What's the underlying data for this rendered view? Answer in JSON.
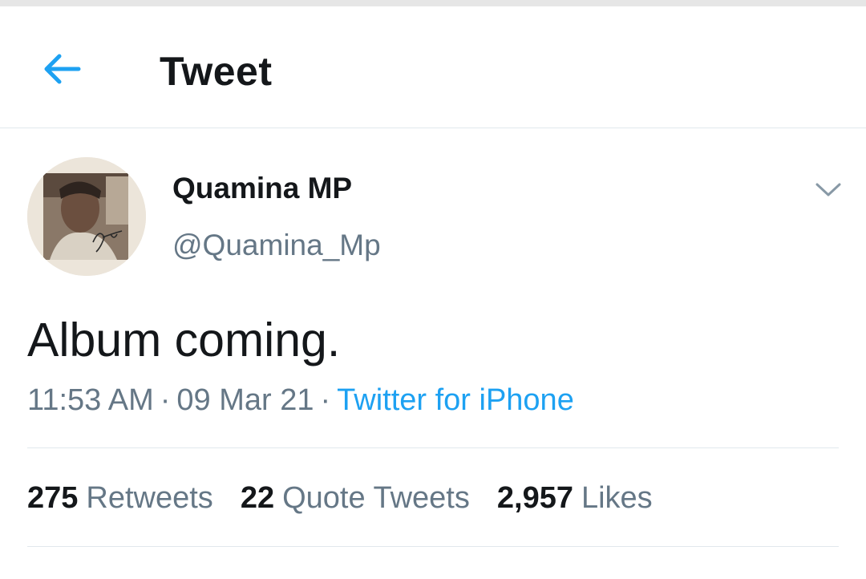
{
  "header": {
    "title": "Tweet",
    "back_icon": "arrow-left-icon"
  },
  "user": {
    "display_name": "Quamina MP",
    "handle": "@Quamina_Mp",
    "avatar": "avatar-photo",
    "signature_text": "Bongo"
  },
  "tweet": {
    "text": "Album coming.",
    "time": "11:53 AM",
    "date": "09 Mar 21",
    "source": "Twitter for iPhone",
    "separator": "·"
  },
  "stats": {
    "retweets_count": "275",
    "retweets_label": "Retweets",
    "quotes_count": "22",
    "quotes_label": "Quote Tweets",
    "likes_count": "2,957",
    "likes_label": "Likes"
  },
  "colors": {
    "accent": "#1da1f2",
    "secondary_text": "#657786",
    "primary_text": "#14171a",
    "divider": "#e1e8ed"
  }
}
